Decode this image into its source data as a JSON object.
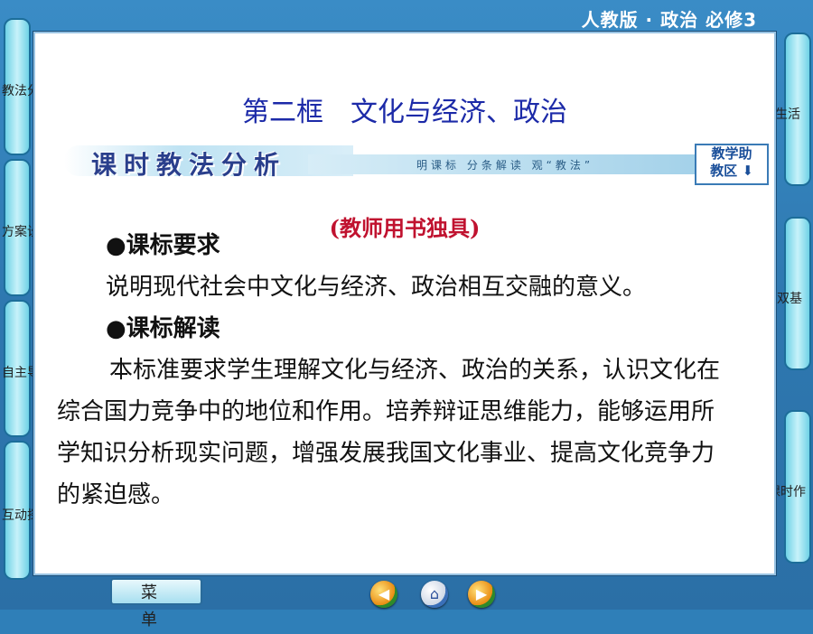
{
  "header": {
    "badge": "人教版 · 政治  必修3"
  },
  "left_tabs": [
    {
      "label": "教法分析"
    },
    {
      "label": "方案设计"
    },
    {
      "label": "自主导学"
    },
    {
      "label": "互动探究"
    }
  ],
  "right_tabs": [
    {
      "label": "课外生活"
    },
    {
      "label": "当堂双基"
    },
    {
      "label": "课时作"
    }
  ],
  "lesson": {
    "title": "第二框　文化与经济、政治",
    "banner_heading": "课时教法分析",
    "banner_sub": "明课标 分条解读 观“教法”",
    "assist_line1": "教学助",
    "assist_line2": "教区 ⬇",
    "teacher_note": "(教师用书独具)",
    "section1_head": "●课标要求",
    "section1_text": "说明现代社会中文化与经济、政治相互交融的意义。",
    "section2_head": "●课标解读",
    "section2_text": "本标准要求学生理解文化与经济、政治的关系，认识文化在综合国力竞争中的地位和作用。培养辩证思维能力，能够运用所学知识分析现实问题，增强发展我国文化事业、提高文化竞争力的紧迫感。"
  },
  "footer": {
    "menu_label": "菜单",
    "icons": [
      "prev-icon",
      "home-icon",
      "next-icon"
    ]
  }
}
